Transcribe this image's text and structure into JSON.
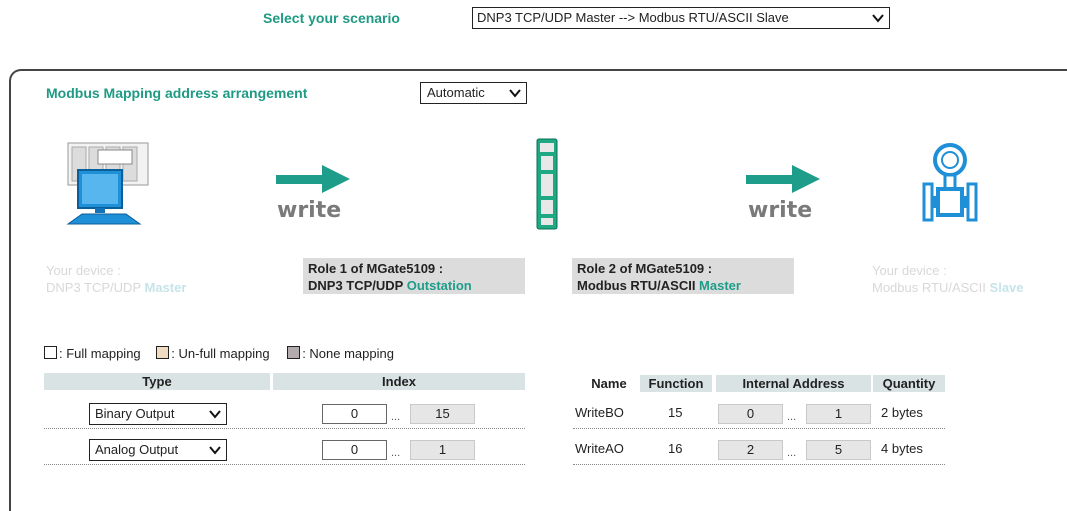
{
  "scenario": {
    "label": "Select your scenario",
    "selected": "DNP3 TCP/UDP Master --> Modbus RTU/ASCII Slave"
  },
  "mapping_arrangement": {
    "label": "Modbus Mapping address arrangement",
    "selected": "Automatic"
  },
  "flow": {
    "write_left": "write",
    "write_right": "write"
  },
  "left_device": {
    "line1": "Your device :",
    "line2": "DNP3 TCP/UDP ",
    "role": "Master"
  },
  "role1": {
    "line1": "Role 1 of MGate5109 :",
    "line2": "DNP3 TCP/UDP ",
    "role": "Outstation"
  },
  "role2": {
    "line1": "Role 2 of MGate5109 :",
    "line2": "Modbus RTU/ASCII ",
    "role": "Master"
  },
  "right_device": {
    "line1": "Your device :",
    "line2": "Modbus RTU/ASCII ",
    "role": "Slave"
  },
  "legend": {
    "full": ": Full mapping",
    "unfull": ": Un-full mapping",
    "none": ": None mapping"
  },
  "left_table": {
    "headers": {
      "type": "Type",
      "index": "Index"
    },
    "rows": [
      {
        "type": "Binary Output",
        "index_start": "0",
        "index_end": "15"
      },
      {
        "type": "Analog Output",
        "index_start": "0",
        "index_end": "1"
      }
    ]
  },
  "right_table": {
    "headers": {
      "name": "Name",
      "function": "Function",
      "internal_address": "Internal Address",
      "quantity": "Quantity"
    },
    "rows": [
      {
        "name": "WriteBO",
        "function": "15",
        "addr_start": "0",
        "addr_end": "1",
        "quantity": "2 bytes"
      },
      {
        "name": "WriteAO",
        "function": "16",
        "addr_start": "2",
        "addr_end": "5",
        "quantity": "4 bytes"
      }
    ]
  },
  "colors": {
    "accent": "#1f9a83",
    "arrow": "#1e9d8a",
    "header_bg": "#d9e3e4",
    "role_bg": "#dcdcdc",
    "unfull": "#efdcc1",
    "none": "#b3abad"
  },
  "ellipsis": "..."
}
